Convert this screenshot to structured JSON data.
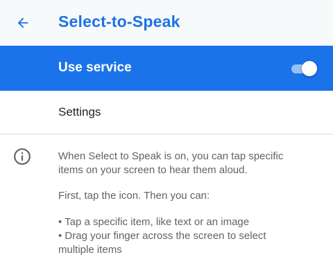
{
  "header": {
    "back_icon": "arrow-left-icon",
    "title": "Select-to-Speak"
  },
  "service": {
    "label": "Use service",
    "toggle_on": true
  },
  "settings": {
    "label": "Settings"
  },
  "info": {
    "icon": "info-icon",
    "paragraph1_line1": "When Select to Speak is on, you can tap specific",
    "paragraph1_line2": "items on your screen to hear them aloud.",
    "paragraph2": "First, tap the icon. Then you can:",
    "bullet1": "• Tap a specific item, like text or an image",
    "bullet2_line1": "• Drag your finger across the screen to select",
    "bullet2_line2": "multiple items"
  },
  "colors": {
    "accent": "#1a73e8",
    "appbar_bg": "#f8f9fa",
    "text_secondary": "#5f6368"
  }
}
